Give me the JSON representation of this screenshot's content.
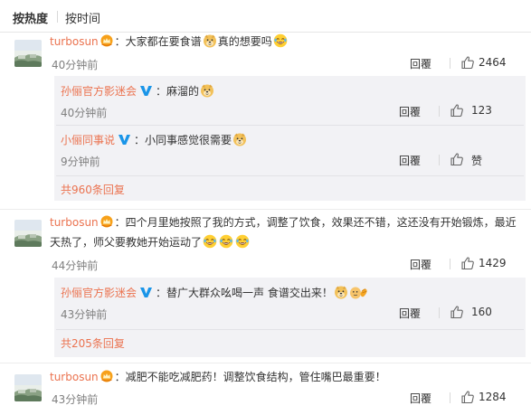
{
  "sort": {
    "hot_label": "按热度",
    "time_label": "按时间"
  },
  "comments": [
    {
      "user": "turbosun",
      "text_a": "：大家都在要食谱",
      "text_b": "真的想要吗",
      "time": "40分钟前",
      "reply_label": "回覆",
      "likes": "2464",
      "replies": [
        {
          "user": "孙俪官方影迷会",
          "text": "：麻溜的",
          "time": "40分钟前",
          "reply_label": "回覆",
          "likes": "123"
        },
        {
          "user": "小俪同事说",
          "text": "：小同事感觉很需要",
          "time": "9分钟前",
          "reply_label": "回覆",
          "likes": "赞"
        }
      ],
      "more": "共960条回复"
    },
    {
      "user": "turbosun",
      "text_line1": "：四个月里她按照了我的方式，调整了饮食，效果还不错，这还没有开始锻炼，最近",
      "text_line2": "天热了，师父要教她开始运动了",
      "time": "44分钟前",
      "reply_label": "回覆",
      "likes": "1429",
      "replies": [
        {
          "user": "孙俪官方影迷会",
          "text": "：替广大群众吆喝一声 食谱交出来！",
          "time": "43分钟前",
          "reply_label": "回覆",
          "likes": "160"
        }
      ],
      "more": "共205条回复"
    },
    {
      "user": "turbosun",
      "text": "：减肥不能吃减肥药！调整饮食结构，管住嘴巴最重要！",
      "time": "43分钟前",
      "reply_label": "回覆",
      "likes": "1284"
    }
  ]
}
